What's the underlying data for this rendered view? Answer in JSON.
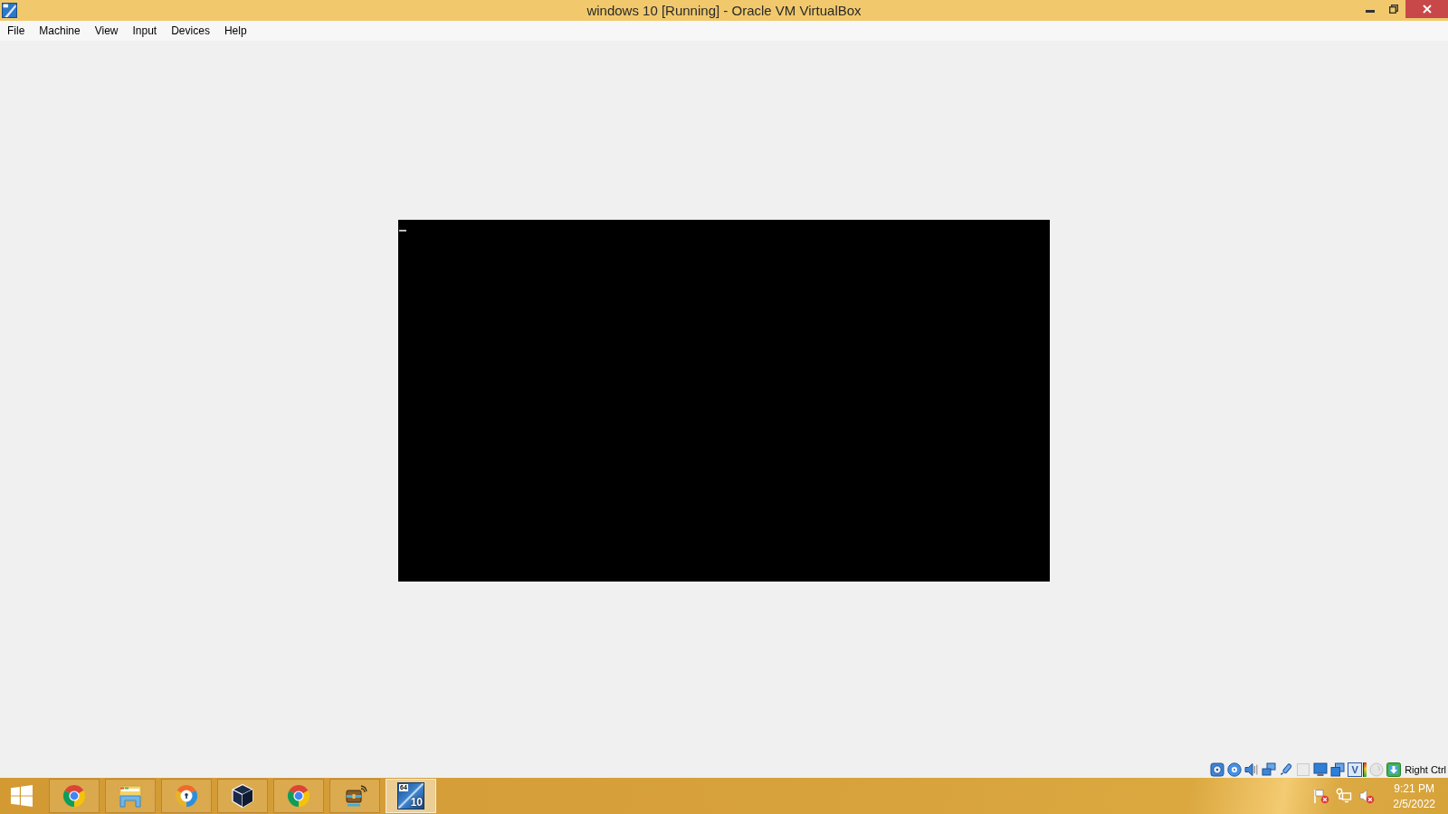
{
  "window": {
    "title": "windows 10 [Running] - Oracle VM VirtualBox"
  },
  "menu_bar": {
    "items": [
      "File",
      "Machine",
      "View",
      "Input",
      "Devices",
      "Help"
    ]
  },
  "vm_screen": {
    "cursor_visible": true
  },
  "status_bar": {
    "indicators": [
      {
        "kind": "hard-disk"
      },
      {
        "kind": "optical-disc"
      },
      {
        "kind": "audio"
      },
      {
        "kind": "network"
      },
      {
        "kind": "usb"
      },
      {
        "kind": "shared-folders"
      },
      {
        "kind": "display"
      },
      {
        "kind": "recording"
      },
      {
        "kind": "virtualization",
        "glyph": "V"
      },
      {
        "kind": "cpu-load"
      },
      {
        "kind": "mouse"
      },
      {
        "kind": "keyboard"
      }
    ],
    "host_key": "Right Ctrl"
  },
  "taskbar": {
    "items": [
      {
        "kind": "chrome",
        "selected": false
      },
      {
        "kind": "file-explorer",
        "selected": false
      },
      {
        "kind": "secure-browser",
        "selected": false
      },
      {
        "kind": "virtualbox",
        "selected": false
      },
      {
        "kind": "chrome",
        "selected": false
      },
      {
        "kind": "network-tool",
        "selected": false
      },
      {
        "kind": "vm",
        "selected": true,
        "icon_labels": [
          "64",
          "10"
        ]
      }
    ],
    "tray": [
      {
        "kind": "action-center",
        "alert": true
      },
      {
        "kind": "network",
        "alert": false
      },
      {
        "kind": "volume",
        "alert": true
      }
    ],
    "clock": {
      "time": "9:21 PM",
      "date": "2/5/2022"
    }
  }
}
